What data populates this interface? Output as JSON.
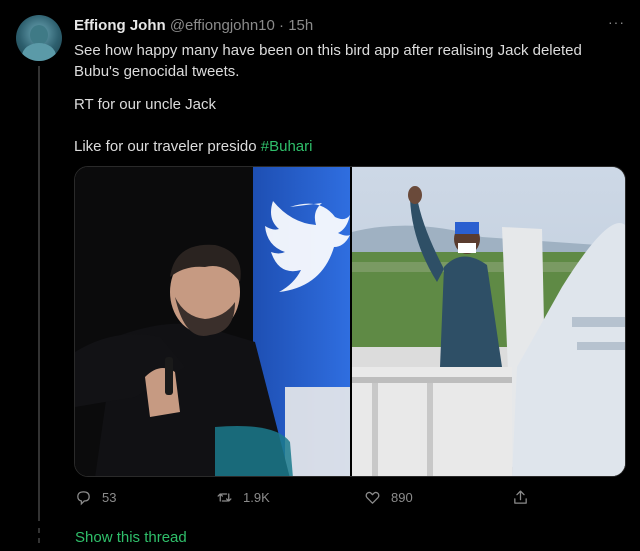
{
  "tweet": {
    "author_name": "Effiong John",
    "handle": "@effiongjohn10",
    "separator": "·",
    "time": "15h",
    "more_label": "···",
    "text_lines": [
      "See how happy many have been on this bird app after realising Jack deleted Bubu's genocidal tweets.",
      "RT for our uncle Jack",
      "Like for our traveler presido "
    ],
    "hashtag": "#Buhari",
    "media": [
      {
        "icon": "photo-man-with-microphone"
      },
      {
        "icon": "photo-man-waving-at-plane"
      }
    ],
    "stats": {
      "replies": "53",
      "retweets": "1.9K",
      "likes": "890"
    },
    "show_thread_label": "Show this thread"
  },
  "colors": {
    "background": "#000000",
    "text": "#d9d9d9",
    "muted": "#8b8b8b",
    "accent": "#2fbf6a"
  }
}
